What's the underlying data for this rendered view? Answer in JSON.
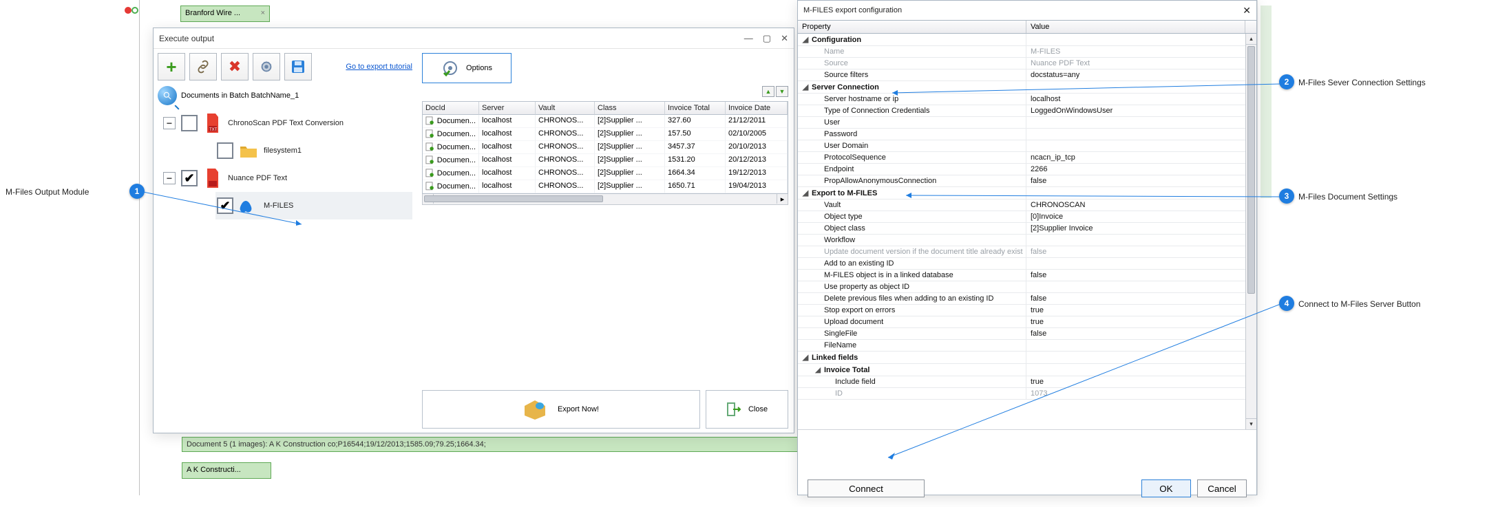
{
  "bg": {
    "top_tab": "Branford Wire ...",
    "doc_bar": "Document 5 (1 images): A K Construction co;P16544;19/12/2013;1585.09;79.25;1664.34;",
    "bottom_tab": "A K Constructi..."
  },
  "exec": {
    "title": "Execute output",
    "tutorial_link": "Go to export tutorial",
    "options_label": "Options",
    "batch_label": "Documents in Batch BatchName_1",
    "tree": {
      "n0": "ChronoScan PDF Text Conversion",
      "n1": "filesystem1",
      "n2": "Nuance PDF Text",
      "n3": "M-FILES"
    },
    "cols": {
      "c0": "DocId",
      "c1": "Server",
      "c2": "Vault",
      "c3": "Class",
      "c4": "Invoice Total",
      "c5": "Invoice Date"
    },
    "rows": [
      {
        "docid": "Documen...",
        "server": "localhost",
        "vault": "CHRONOS...",
        "class": "[2]Supplier ...",
        "total": "327.60",
        "date": "21/12/2011"
      },
      {
        "docid": "Documen...",
        "server": "localhost",
        "vault": "CHRONOS...",
        "class": "[2]Supplier ...",
        "total": "157.50",
        "date": "02/10/2005"
      },
      {
        "docid": "Documen...",
        "server": "localhost",
        "vault": "CHRONOS...",
        "class": "[2]Supplier ...",
        "total": "3457.37",
        "date": "20/10/2013"
      },
      {
        "docid": "Documen...",
        "server": "localhost",
        "vault": "CHRONOS...",
        "class": "[2]Supplier ...",
        "total": "1531.20",
        "date": "20/12/2013"
      },
      {
        "docid": "Documen...",
        "server": "localhost",
        "vault": "CHRONOS...",
        "class": "[2]Supplier ...",
        "total": "1664.34",
        "date": "19/12/2013"
      },
      {
        "docid": "Documen...",
        "server": "localhost",
        "vault": "CHRONOS...",
        "class": "[2]Supplier ...",
        "total": "1650.71",
        "date": "19/04/2013"
      }
    ],
    "export_label": "Export Now!",
    "close_label": "Close"
  },
  "mf": {
    "title": "M-FILES export configuration",
    "head_prop": "Property",
    "head_val": "Value",
    "rows": [
      {
        "type": "group",
        "p": "Configuration",
        "v": ""
      },
      {
        "type": "sub",
        "disabled": true,
        "p": "Name",
        "v": "M-FILES"
      },
      {
        "type": "sub",
        "disabled": true,
        "p": "Source",
        "v": "Nuance PDF Text"
      },
      {
        "type": "sub",
        "p": "Source filters",
        "v": "docstatus=any"
      },
      {
        "type": "group",
        "p": "Server Connection",
        "v": ""
      },
      {
        "type": "sub",
        "p": "Server hostname or ip",
        "v": "localhost"
      },
      {
        "type": "sub",
        "p": "Type of Connection Credentials",
        "v": "LoggedOnWindowsUser"
      },
      {
        "type": "sub",
        "p": "User",
        "v": ""
      },
      {
        "type": "sub",
        "p": "Password",
        "v": ""
      },
      {
        "type": "sub",
        "p": "User Domain",
        "v": ""
      },
      {
        "type": "sub",
        "p": "ProtocolSequence",
        "v": "ncacn_ip_tcp"
      },
      {
        "type": "sub",
        "p": "Endpoint",
        "v": "2266"
      },
      {
        "type": "sub",
        "p": "PropAllowAnonymousConnection",
        "v": "false"
      },
      {
        "type": "group",
        "p": "Export to M-FILES",
        "v": ""
      },
      {
        "type": "sub",
        "p": "Vault",
        "v": "CHRONOSCAN"
      },
      {
        "type": "sub",
        "p": "Object type",
        "v": "[0]Invoice"
      },
      {
        "type": "sub",
        "p": "Object class",
        "v": "[2]Supplier Invoice"
      },
      {
        "type": "sub",
        "p": "Workflow",
        "v": ""
      },
      {
        "type": "sub",
        "disabled": true,
        "p": "Update document version if the document title already exist",
        "v": "false"
      },
      {
        "type": "sub",
        "p": "Add to an existing ID",
        "v": ""
      },
      {
        "type": "sub",
        "p": "M-FILES object is in a linked database",
        "v": "false"
      },
      {
        "type": "sub",
        "p": "Use property as object ID",
        "v": ""
      },
      {
        "type": "sub",
        "p": "Delete previous files when adding to an existing ID",
        "v": "false"
      },
      {
        "type": "sub",
        "p": "Stop export on errors",
        "v": "true"
      },
      {
        "type": "sub",
        "p": "Upload document",
        "v": "true"
      },
      {
        "type": "sub",
        "p": "SingleFile",
        "v": "false"
      },
      {
        "type": "sub",
        "p": "FileName",
        "v": ""
      },
      {
        "type": "group",
        "p": "Linked fields",
        "v": ""
      },
      {
        "type": "subgroup",
        "p": "Invoice Total",
        "v": ""
      },
      {
        "type": "sub2",
        "p": "Include field",
        "v": "true"
      },
      {
        "type": "sub2",
        "disabled": true,
        "p": "ID",
        "v": "1073"
      }
    ],
    "connect": "Connect",
    "ok": "OK",
    "cancel": "Cancel"
  },
  "callouts": {
    "c1": "M-Files Output Module",
    "c2": "M-Files Sever Connection Settings",
    "c3": "M-Files Document Settings",
    "c4": "Connect to M-Files Server Button"
  }
}
